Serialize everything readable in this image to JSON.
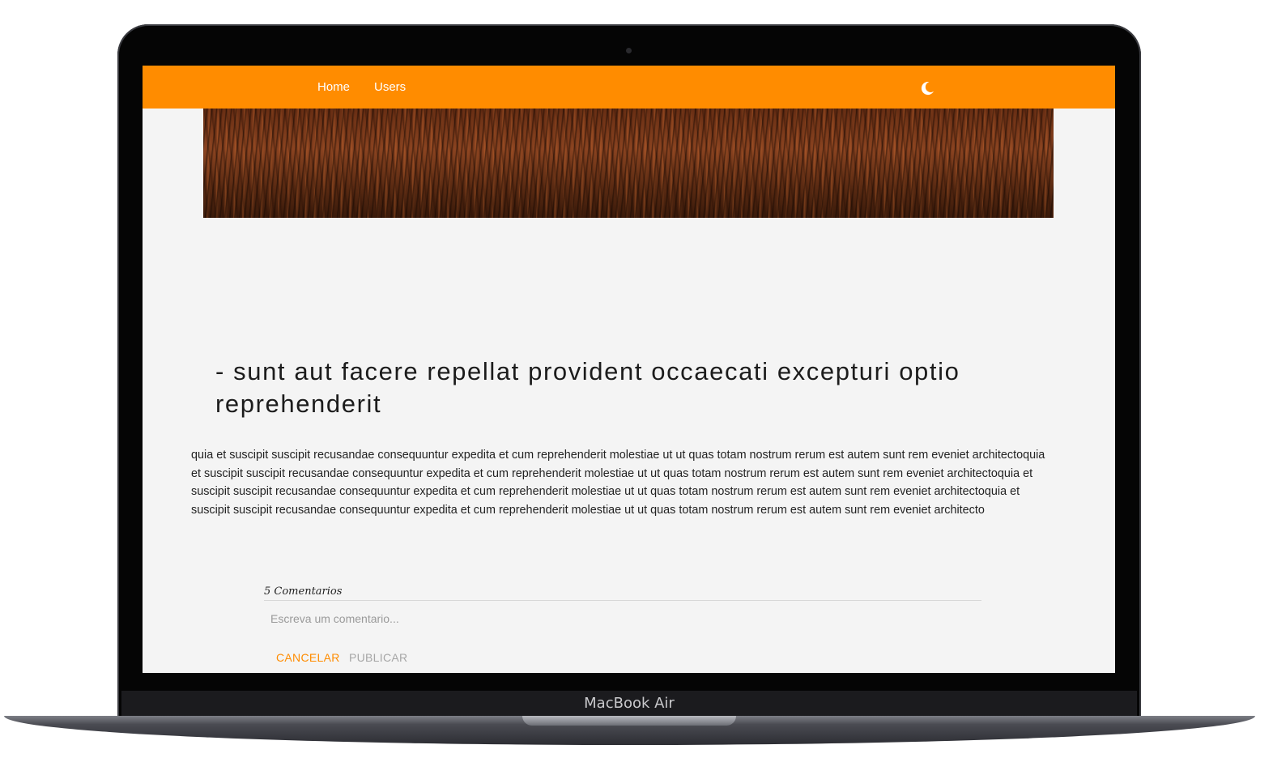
{
  "device": {
    "label": "MacBook Air"
  },
  "navbar": {
    "items": [
      {
        "label": "Home"
      },
      {
        "label": "Users"
      }
    ],
    "theme_icon": "moon-icon",
    "color": "#ff8c00"
  },
  "post": {
    "title": "- sunt aut facere repellat provident occaecati excepturi optio reprehenderit",
    "body": "quia et suscipit suscipit recusandae consequuntur expedita et cum reprehenderit molestiae ut ut quas totam nostrum rerum est autem sunt rem eveniet architectoquia et suscipit suscipit recusandae consequuntur expedita et cum reprehenderit molestiae ut ut quas totam nostrum rerum est autem sunt rem eveniet architectoquia et suscipit suscipit recusandae consequuntur expedita et cum reprehenderit molestiae ut ut quas totam nostrum rerum est autem sunt rem eveniet architectoquia et suscipit suscipit recusandae consequuntur expedita et cum reprehenderit molestiae ut ut quas totam nostrum rerum est autem sunt rem eveniet architecto"
  },
  "comments": {
    "count_label": "5 Comentarios",
    "input_placeholder": "Escreva um comentario...",
    "cancel_label": "CANCELAR",
    "publish_label": "PUBLICAR",
    "cancel_color": "#ff8c00",
    "publish_color": "#a6a6a6"
  }
}
